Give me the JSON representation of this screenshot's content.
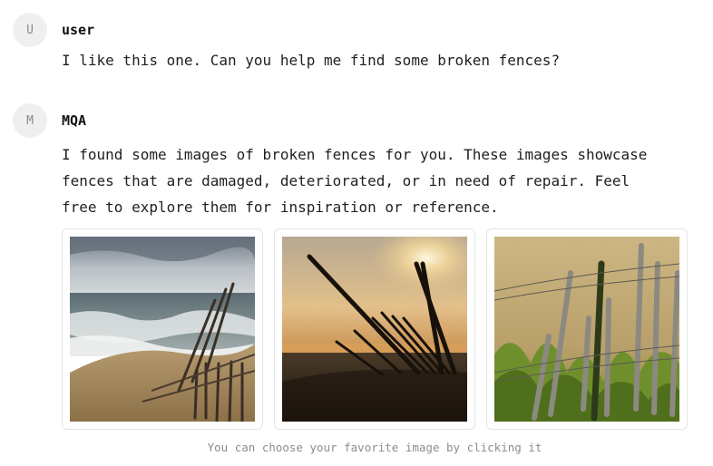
{
  "conversation": {
    "messages": [
      {
        "avatar_letter": "U",
        "author": "user",
        "text": "I like this one. Can you help me find some broken fences?"
      },
      {
        "avatar_letter": "M",
        "author": "MQA",
        "text_lines": [
          "I found some images of broken fences for you. These images showcase",
          "fences that are damaged, deteriorated, or in need of repair. Feel",
          "free to explore them for inspiration or reference."
        ]
      }
    ],
    "images": [
      {
        "description": "beach-fence-photo"
      },
      {
        "description": "sunset-fence-photo"
      },
      {
        "description": "grass-fence-photo"
      }
    ],
    "hint": "You can choose your favorite image by clicking it"
  }
}
